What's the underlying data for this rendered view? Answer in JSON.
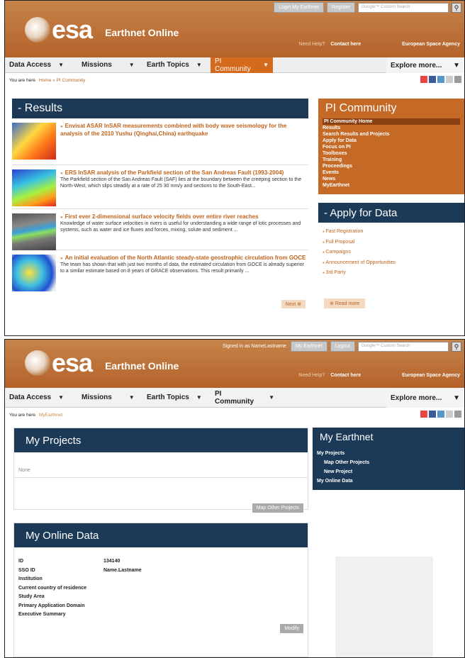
{
  "p1": {
    "top_buttons": [
      "Login My Earthnet",
      "Register"
    ],
    "search_placeholder": "Google™ Custom Search",
    "need_help": "Need Help?",
    "contact": "Contact here",
    "agency": "European Space Agency",
    "brand": "esa",
    "site": "Earthnet Online",
    "nav": [
      "Data Access",
      "Missions",
      "Earth Topics",
      "PI Community"
    ],
    "explore": "Explore more...",
    "crumb_label": "You are here",
    "crumb_link": "Home » PI Community",
    "results_title": "- Results",
    "items": [
      {
        "title": "Envisat ASAR InSAR measurements combined with body wave seismology for the analysis of the 2010 Yushu (Qinghai,China) earthquake",
        "text": ""
      },
      {
        "title": "ERS InSAR analysis of the Parkfield section of the San Andreas Fault (1993-2004)",
        "text": "The Parkfield section of the San Andreas Fault (SAF) lies at the boundary between the creeping section to the North-West, which slips steadily at a rate of 25 30 mm/y and sections to the South-East..."
      },
      {
        "title": "First ever 2-dimensional surface velocity fields over entire river reaches",
        "text": "Knowledge of water surface velocities in rivers is useful for understanding a wide range of lotic processes and systems, such as water and ice fluxes and forces, mixing, solute and sediment ..."
      },
      {
        "title": "An initial evaluation of the North Atlantic steady-state geostrophic circulation from GOCE",
        "text": "The team has shown that with just two months of data, the estimated circulation from GOCE is already superior to a similar estimate based on 8 years of GRACE observations. This result primarily ..."
      }
    ],
    "next": "Next ⊕",
    "pi_title": "PI Community",
    "pi_links": [
      "PI Community Home",
      "Results",
      "Search Results and Projects",
      "Apply for Data",
      "Focus on PI",
      "Toolboxes",
      "Training",
      "Proceedings",
      "Events",
      "News",
      "MyEarthnet"
    ],
    "apply_title": "- Apply for Data",
    "apply_links": [
      "Fast Registration",
      "Full Proposal",
      "Campaigns",
      "Announcement of Opportunities",
      "3rd Party"
    ],
    "read_more": "⊕ Read more"
  },
  "p2": {
    "signed_in": "Signed in as NameLastname",
    "top_buttons": [
      "My Earthnet",
      "Logout"
    ],
    "search_placeholder": "Google™ Custom Search",
    "need_help": "Need Help?",
    "contact": "Contact here",
    "agency": "European Space Agency",
    "brand": "esa",
    "site": "Earthnet Online",
    "nav": [
      "Data Access",
      "Missions",
      "Earth Topics",
      "PI Community"
    ],
    "explore": "Explore more...",
    "crumb_label": "You are here",
    "crumb_link": "MyEarthnet",
    "projects_title": "My Projects",
    "none": "None",
    "map_btn": "Map Other Projects",
    "online_title": "My Online Data",
    "fields": [
      {
        "k": "ID",
        "v": "134140"
      },
      {
        "k": "SSO ID",
        "v": "Name.Lastname"
      },
      {
        "k": "Institution",
        "v": ""
      },
      {
        "k": "Current country of residence",
        "v": ""
      },
      {
        "k": "Study Area",
        "v": ""
      },
      {
        "k": "Primary Application Domain",
        "v": ""
      },
      {
        "k": "Executive Summary",
        "v": ""
      }
    ],
    "modify": "Modify",
    "side_title": "My Earthnet",
    "side_links": [
      "My Projects",
      "Map Other Projects",
      "New Project",
      "My Online Data"
    ]
  }
}
